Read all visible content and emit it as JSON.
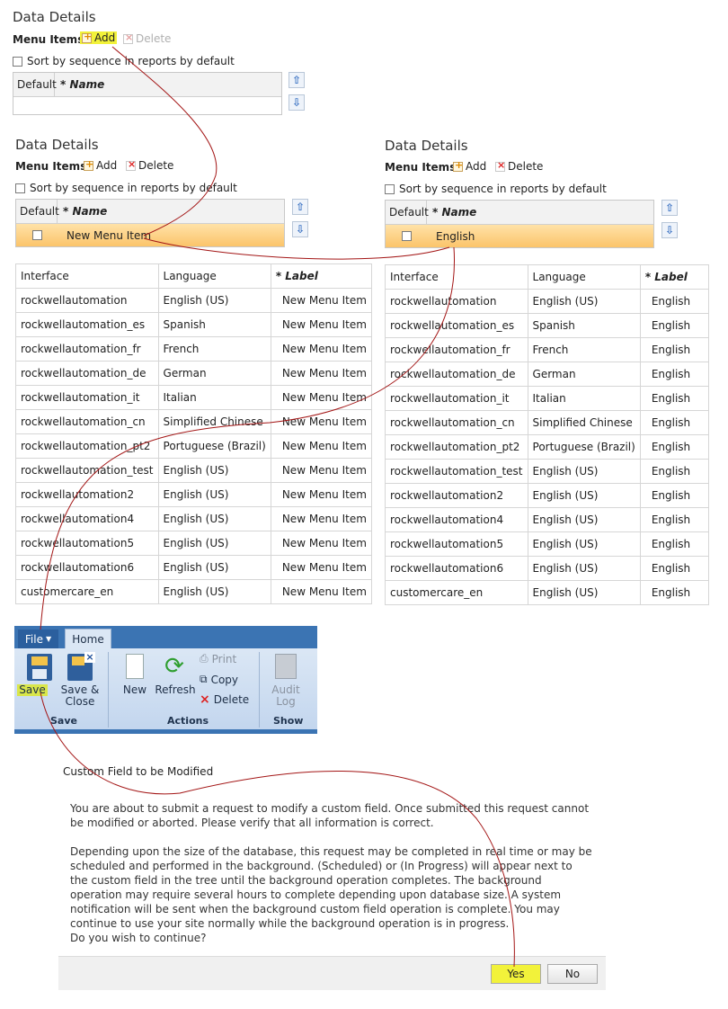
{
  "panel_top": {
    "title": "Data Details",
    "menu_label": "Menu Items",
    "add_label": "Add",
    "delete_label": "Delete",
    "sort_label": "Sort by sequence in reports by default",
    "col_default": "Default",
    "col_name": "* Name"
  },
  "panel_left": {
    "title": "Data Details",
    "menu_label": "Menu Items",
    "add_label": "Add",
    "delete_label": "Delete",
    "sort_label": "Sort by sequence in reports by default",
    "col_default": "Default",
    "col_name": "* Name",
    "row_name": "New Menu Item"
  },
  "panel_right": {
    "title": "Data Details",
    "menu_label": "Menu Items",
    "add_label": "Add",
    "delete_label": "Delete",
    "sort_label": "Sort by sequence in reports by default",
    "col_default": "Default",
    "col_name": "* Name",
    "row_name": "English"
  },
  "table_headers": {
    "interface": "Interface",
    "language": "Language",
    "label": "* Label"
  },
  "table_left": [
    {
      "interface": "rockwellautomation",
      "language": "English (US)",
      "label": "New Menu Item"
    },
    {
      "interface": "rockwellautomation_es",
      "language": "Spanish",
      "label": "New Menu Item"
    },
    {
      "interface": "rockwellautomation_fr",
      "language": "French",
      "label": "New Menu Item"
    },
    {
      "interface": "rockwellautomation_de",
      "language": "German",
      "label": "New Menu Item"
    },
    {
      "interface": "rockwellautomation_it",
      "language": "Italian",
      "label": "New Menu Item"
    },
    {
      "interface": "rockwellautomation_cn",
      "language": "Simplified Chinese",
      "label": "New Menu Item"
    },
    {
      "interface": "rockwellautomation_pt2",
      "language": "Portuguese (Brazil)",
      "label": "New Menu Item"
    },
    {
      "interface": "rockwellautomation_test",
      "language": "English (US)",
      "label": "New Menu Item"
    },
    {
      "interface": "rockwellautomation2",
      "language": "English (US)",
      "label": "New Menu Item"
    },
    {
      "interface": "rockwellautomation4",
      "language": "English (US)",
      "label": "New Menu Item"
    },
    {
      "interface": "rockwellautomation5",
      "language": "English (US)",
      "label": "New Menu Item"
    },
    {
      "interface": "rockwellautomation6",
      "language": "English (US)",
      "label": "New Menu Item"
    },
    {
      "interface": "customercare_en",
      "language": "English (US)",
      "label": "New Menu Item"
    }
  ],
  "table_right": [
    {
      "interface": "rockwellautomation",
      "language": "English (US)",
      "label": "English"
    },
    {
      "interface": "rockwellautomation_es",
      "language": "Spanish",
      "label": "English"
    },
    {
      "interface": "rockwellautomation_fr",
      "language": "French",
      "label": "English"
    },
    {
      "interface": "rockwellautomation_de",
      "language": "German",
      "label": "English"
    },
    {
      "interface": "rockwellautomation_it",
      "language": "Italian",
      "label": "English"
    },
    {
      "interface": "rockwellautomation_cn",
      "language": "Simplified Chinese",
      "label": "English"
    },
    {
      "interface": "rockwellautomation_pt2",
      "language": "Portuguese (Brazil)",
      "label": "English"
    },
    {
      "interface": "rockwellautomation_test",
      "language": "English (US)",
      "label": "English"
    },
    {
      "interface": "rockwellautomation2",
      "language": "English (US)",
      "label": "English"
    },
    {
      "interface": "rockwellautomation4",
      "language": "English (US)",
      "label": "English"
    },
    {
      "interface": "rockwellautomation5",
      "language": "English (US)",
      "label": "English"
    },
    {
      "interface": "rockwellautomation6",
      "language": "English (US)",
      "label": "English"
    },
    {
      "interface": "customercare_en",
      "language": "English (US)",
      "label": "English"
    }
  ],
  "ribbon": {
    "file_tab": "File",
    "home_tab": "Home",
    "save": "Save",
    "save_close_line1": "Save &",
    "save_close_line2": "Close",
    "group_save": "Save",
    "new": "New",
    "refresh": "Refresh",
    "print": "Print",
    "copy": "Copy",
    "delete": "Delete",
    "group_actions": "Actions",
    "audit_line1": "Audit",
    "audit_line2": "Log",
    "group_show": "Show"
  },
  "dialog": {
    "title": "Custom Field to be Modified",
    "para1": "You are about to submit a request to modify a custom field.  Once submitted this request cannot be modified or aborted.  Please verify that all information is correct.",
    "para2": "Depending upon the size of the database, this request may be completed in real time or may be scheduled and performed in the background.  (Scheduled) or (In Progress) will appear next to the custom field in the tree until the background operation completes.  The background operation may require several hours to complete depending upon database size.  A system notification will be sent when the background custom field operation is complete.  You may continue to use your site normally while the background operation is in progress.",
    "question": "Do you wish to continue?",
    "yes": "Yes",
    "no": "No"
  },
  "colors": {
    "highlight": "#f2f23a",
    "selected_row": "#fbc46a",
    "ribbon_blue": "#3b74b3",
    "annotation_line": "#a31515"
  }
}
